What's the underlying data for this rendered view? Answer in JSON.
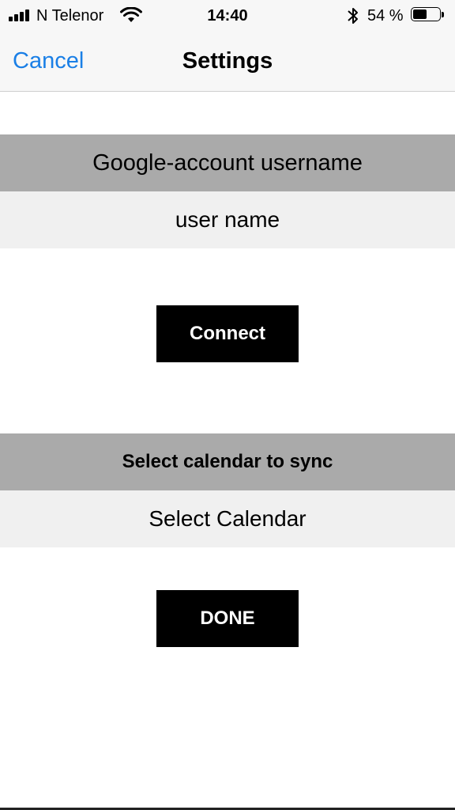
{
  "status_bar": {
    "carrier": "N Telenor",
    "time": "14:40",
    "battery_text": "54 %",
    "battery_level": 0.54,
    "icons": [
      "signal-icon",
      "wifi-icon",
      "bluetooth-icon",
      "battery-icon"
    ]
  },
  "nav": {
    "cancel_label": "Cancel",
    "title": "Settings",
    "accent_color": "#1a7fe6"
  },
  "account_section": {
    "header": "Google-account username",
    "value": "user name",
    "button_label": "Connect"
  },
  "calendar_section": {
    "header": "Select calendar to sync",
    "value": "Select Calendar",
    "button_label": "DONE"
  },
  "colors": {
    "section_header_bg": "#aaaaaa",
    "section_value_bg": "#f0f0f0",
    "button_bg": "#000000",
    "button_text": "#ffffff"
  }
}
